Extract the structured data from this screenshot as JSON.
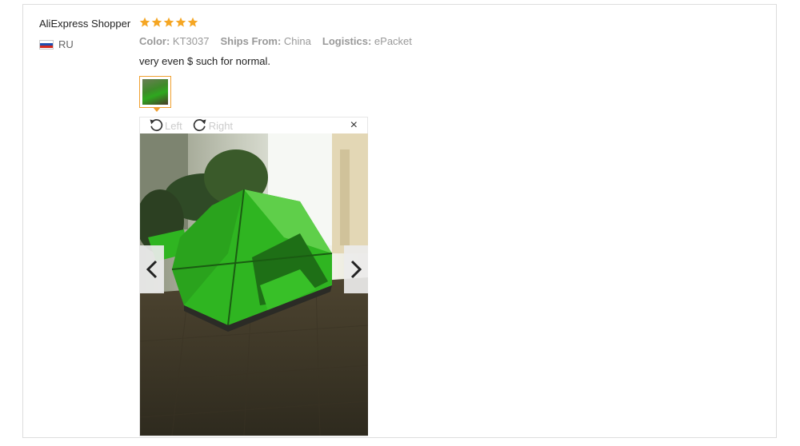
{
  "review": {
    "reviewer": "AliExpress Shopper",
    "rating": 5,
    "country_code": "RU",
    "attributes": [
      {
        "key": "Color:",
        "value": "KT3037"
      },
      {
        "key": "Ships From:",
        "value": "China"
      },
      {
        "key": "Logistics:",
        "value": "ePacket"
      }
    ],
    "text": "very even $ such for normal."
  },
  "viewer": {
    "rotate_left_label": "Left",
    "rotate_right_label": "Right",
    "close_glyph": "×"
  },
  "colors": {
    "star": "#f5a623",
    "accent": "#f0a030",
    "tent": "#2fb521"
  },
  "icons": [
    "star-icon",
    "flag-icon",
    "rotate-left-icon",
    "rotate-right-icon",
    "close-icon",
    "chevron-left-icon",
    "chevron-right-icon"
  ]
}
